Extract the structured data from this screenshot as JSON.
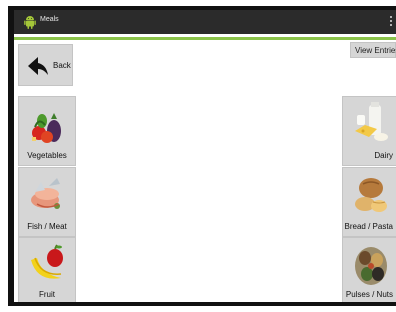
{
  "app": {
    "title": "Meals"
  },
  "nav": {
    "back_label": "Back",
    "view_entries_label": "View Entries"
  },
  "categories": {
    "left": [
      {
        "label": "Vegetables",
        "icon": "vegetables-image"
      },
      {
        "label": "Fish / Meat",
        "icon": "fish-meat-image"
      },
      {
        "label": "Fruit",
        "icon": "fruit-image"
      }
    ],
    "right": [
      {
        "label": "Dairy",
        "icon": "dairy-image"
      },
      {
        "label": "Bread / Pasta",
        "icon": "bread-pasta-image"
      },
      {
        "label": "Pulses / Nuts",
        "icon": "pulses-nuts-image"
      }
    ]
  },
  "colors": {
    "action_bar": "#2b2b2b",
    "accent_green": "#8bc34a",
    "button_gray": "#d6d6d6"
  }
}
